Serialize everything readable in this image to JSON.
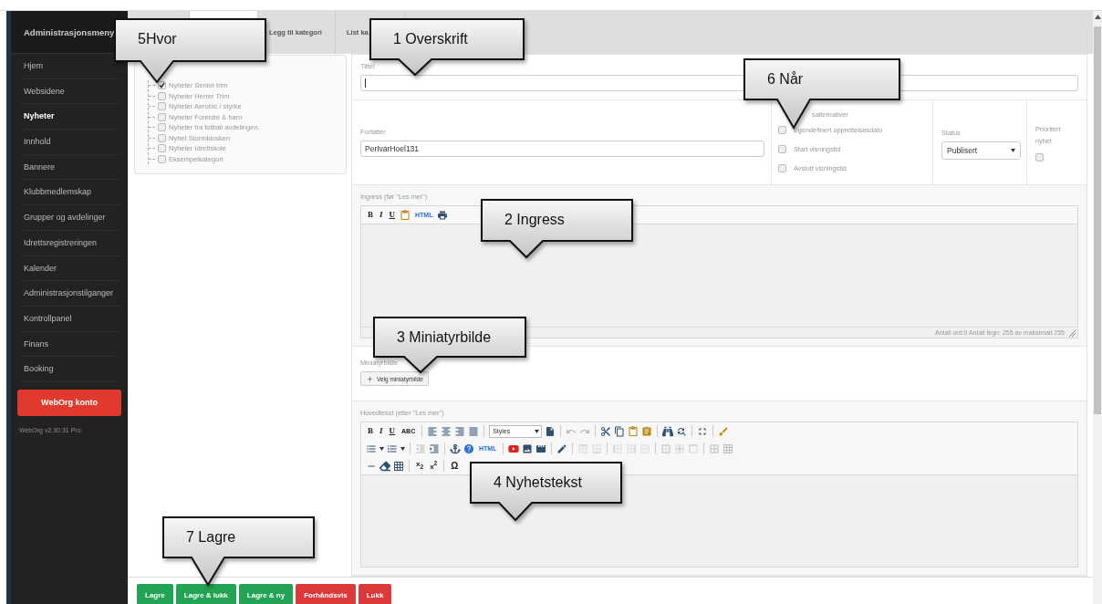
{
  "sidebar": {
    "title": "Administrasjonsmeny",
    "items": [
      {
        "label": "Hjem",
        "selected": false
      },
      {
        "label": "Websidene",
        "selected": false
      },
      {
        "label": "Nyheter",
        "selected": true
      },
      {
        "label": "Innhold",
        "selected": false
      },
      {
        "label": "Bannere",
        "selected": false
      },
      {
        "label": "Klubbmedlemskap",
        "selected": false
      },
      {
        "label": "Grupper og avdelinger",
        "selected": false
      },
      {
        "label": "Idrettsregistreringen",
        "selected": false
      },
      {
        "label": "Kalender",
        "selected": false
      },
      {
        "label": "Administrasjonstilganger",
        "selected": false
      },
      {
        "label": "Kontrollpanel",
        "selected": false
      },
      {
        "label": "Finans",
        "selected": false
      },
      {
        "label": "Booking",
        "selected": false
      }
    ],
    "account_button": "WebOrg konto",
    "version": "WebOrg v2.30.31 Pro"
  },
  "tabs": [
    {
      "selected": false
    },
    {
      "selected": true
    },
    {
      "label": "Legg til kategori",
      "selected": false
    },
    {
      "label": "List ka",
      "selected": false
    }
  ],
  "categories": [
    {
      "label": "Nyheter Senior trim",
      "checked": true
    },
    {
      "label": "Nyheter Herrer Trim",
      "checked": false
    },
    {
      "label": "Nyheter Aerobic / styrke",
      "checked": false
    },
    {
      "label": "Nyheter Foreldre & barn",
      "checked": false
    },
    {
      "label": "Nyheter fra fotball avdelingen.",
      "checked": false
    },
    {
      "label": "Nyhet Stormkiosken",
      "checked": false
    },
    {
      "label": "Nyheter Idrettskole",
      "checked": false
    },
    {
      "label": "Eksempelkategori",
      "checked": false
    }
  ],
  "form": {
    "title_field": {
      "label": "Tittel"
    },
    "author": {
      "label": "Forfatter",
      "value": "PerIvarHoel131"
    },
    "publishing": {
      "heading": "salternativer",
      "options": [
        {
          "label": "Egendefinert opprettelsesdato",
          "checked": false
        },
        {
          "label": "Start visningstid",
          "checked": false
        },
        {
          "label": "Avslutt visningstid",
          "checked": false
        }
      ]
    },
    "status": {
      "label": "Status",
      "value": "Publisert"
    },
    "priority": {
      "label": "Prioritert nyhet",
      "checked": false
    },
    "intro": {
      "label": "Ingress (før \"Les mer\")",
      "counter": "Antall ord:0 Antall tegn: 255 av maksimalt 255",
      "toolbar": [
        {
          "kind": "bold",
          "label": "B"
        },
        {
          "kind": "italic",
          "label": "I"
        },
        {
          "kind": "underline",
          "label": "U"
        },
        {
          "kind": "paste"
        },
        {
          "kind": "html",
          "label": "HTML"
        },
        {
          "kind": "print"
        }
      ]
    },
    "thumbnail": {
      "label": "Miniatyrbilde",
      "button": "Velg miniatyrbilde"
    },
    "body": {
      "label": "Hovedtekst (etter \"Les mer\")",
      "toolbar_rows": [
        [
          {
            "kind": "bold",
            "label": "B"
          },
          {
            "kind": "italic",
            "label": "I"
          },
          {
            "kind": "underline",
            "label": "U"
          },
          {
            "kind": "strike",
            "label": "ABC"
          },
          {
            "kind": "sep"
          },
          {
            "kind": "alignleft"
          },
          {
            "kind": "aligncenter"
          },
          {
            "kind": "alignright"
          },
          {
            "kind": "justify"
          },
          {
            "kind": "sep"
          },
          {
            "kind": "select",
            "label": "Styles"
          },
          {
            "kind": "newdoc"
          },
          {
            "kind": "sep"
          },
          {
            "kind": "undo",
            "disabled": true
          },
          {
            "kind": "redo",
            "disabled": true
          },
          {
            "kind": "sep"
          },
          {
            "kind": "cut"
          },
          {
            "kind": "copy"
          },
          {
            "kind": "paste"
          },
          {
            "kind": "pasteword"
          },
          {
            "kind": "sep"
          },
          {
            "kind": "find"
          },
          {
            "kind": "replace"
          },
          {
            "kind": "sep"
          },
          {
            "kind": "fullscreen"
          },
          {
            "kind": "sep"
          },
          {
            "kind": "cleanup"
          }
        ],
        [
          {
            "kind": "bullist"
          },
          {
            "kind": "numlist"
          },
          {
            "kind": "sep"
          },
          {
            "kind": "outdent",
            "disabled": true
          },
          {
            "kind": "indent"
          },
          {
            "kind": "sep"
          },
          {
            "kind": "anchor"
          },
          {
            "kind": "help"
          },
          {
            "kind": "html",
            "label": "HTML"
          },
          {
            "kind": "sep"
          },
          {
            "kind": "youtube"
          },
          {
            "kind": "image"
          },
          {
            "kind": "media"
          },
          {
            "kind": "sep"
          },
          {
            "kind": "edit"
          },
          {
            "kind": "sep"
          },
          {
            "kind": "rowabove",
            "disabled": true
          },
          {
            "kind": "rowbelow",
            "disabled": true
          },
          {
            "kind": "sep"
          },
          {
            "kind": "colleft",
            "disabled": true
          },
          {
            "kind": "colright",
            "disabled": true
          },
          {
            "kind": "delrow",
            "disabled": true
          },
          {
            "kind": "sep"
          },
          {
            "kind": "merge",
            "disabled": true
          },
          {
            "kind": "split",
            "disabled": true
          },
          {
            "kind": "delcol",
            "disabled": true
          },
          {
            "kind": "sep"
          },
          {
            "kind": "rowprops",
            "disabled": true
          },
          {
            "kind": "cellprops",
            "disabled": true
          }
        ],
        [
          {
            "kind": "hr"
          },
          {
            "kind": "eraser"
          },
          {
            "kind": "table"
          },
          {
            "kind": "sep"
          },
          {
            "kind": "sub",
            "label": "x$_{2}$"
          },
          {
            "kind": "sup",
            "label": "x$^{2}$"
          },
          {
            "kind": "sep"
          },
          {
            "kind": "symbol",
            "label": "Ω"
          }
        ]
      ]
    }
  },
  "actions": [
    {
      "label": "Lagre",
      "color": "#23a455"
    },
    {
      "label": "Lagre & lukk",
      "color": "#23a455"
    },
    {
      "label": "Lagre & ny",
      "color": "#23a455"
    },
    {
      "label": "Forhåndsvis",
      "color": "#dc3a3a"
    },
    {
      "label": "Lukk",
      "color": "#dc3a3a"
    }
  ],
  "callouts": [
    {
      "label": "5Hvor"
    },
    {
      "label": "1 Overskrift"
    },
    {
      "label": "6 Når"
    },
    {
      "label": "2 Ingress"
    },
    {
      "label": "3 Miniatyrbilde"
    },
    {
      "label": "4 Nyhetstekst"
    },
    {
      "label": "7 Lagre"
    }
  ]
}
